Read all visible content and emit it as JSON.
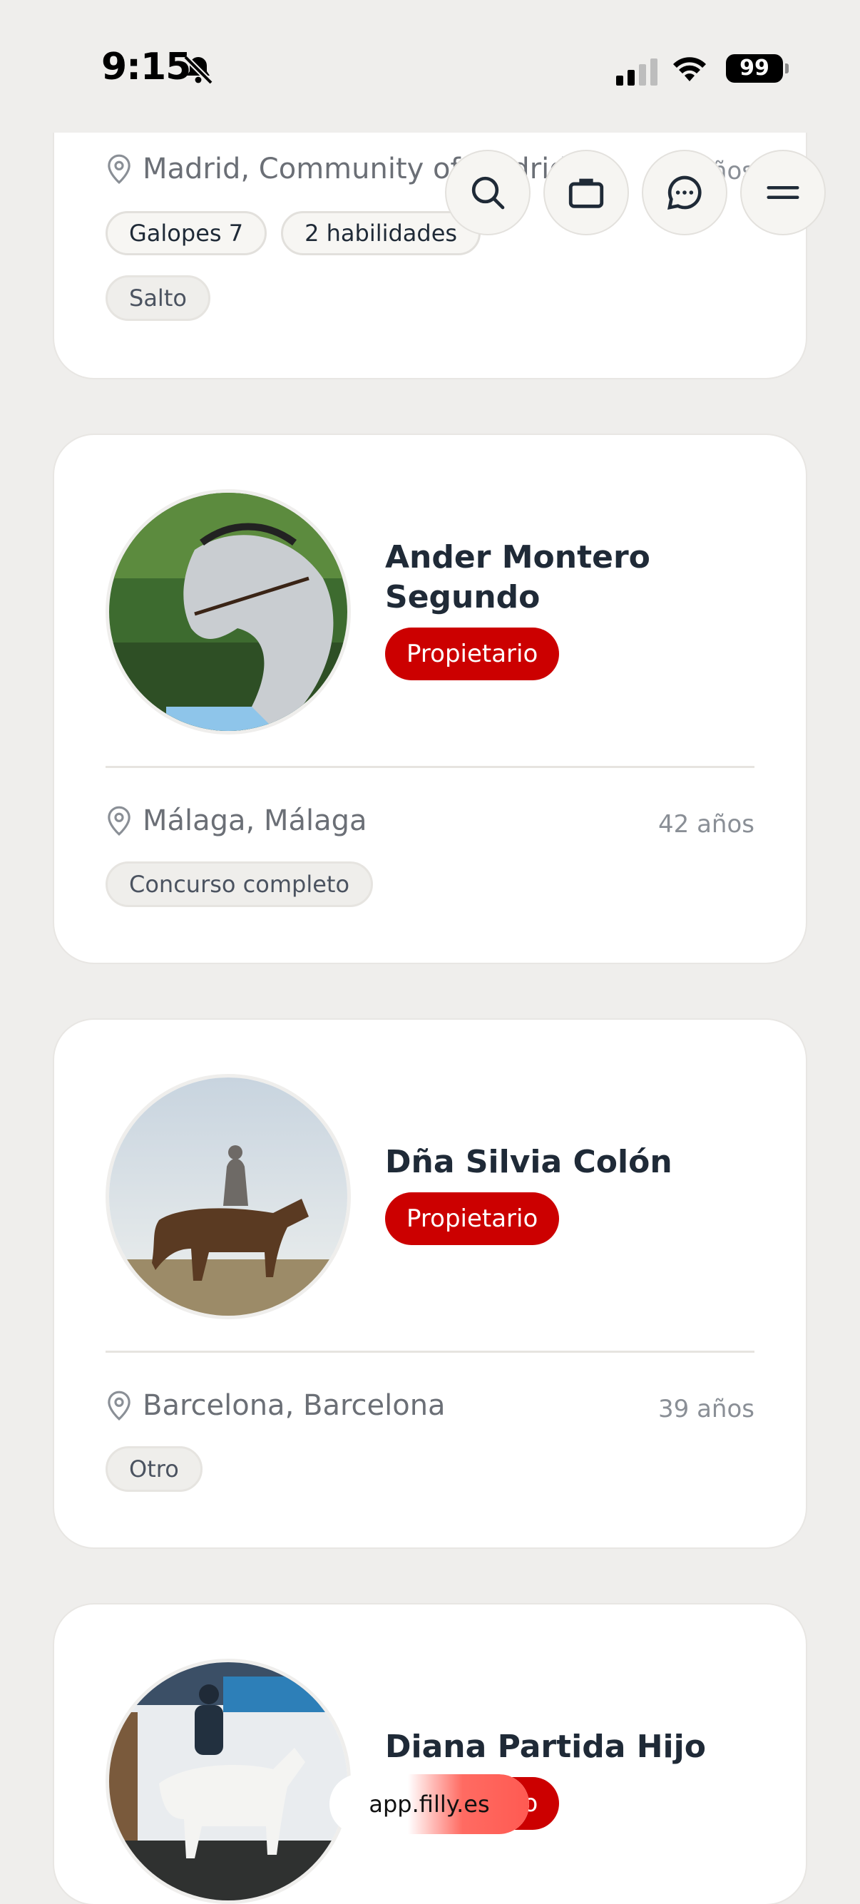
{
  "status": {
    "time": "9:15",
    "battery": "99"
  },
  "top_card": {
    "location": "Madrid, Community of Madrid",
    "age": "años",
    "chips": [
      "Galopes 7",
      "2 habilidades"
    ],
    "discipline": "Salto"
  },
  "nav": {
    "icons": [
      "search-icon",
      "briefcase-icon",
      "chat-icon",
      "menu-icon"
    ]
  },
  "riders": [
    {
      "name_line1": "Ander Montero",
      "name_line2": "Segundo",
      "role": "Propietario",
      "location": "Málaga, Málaga",
      "age": "42 años",
      "discipline": "Concurso completo"
    },
    {
      "name_line1": "Dña Silvia Colón",
      "name_line2": "",
      "role": "Propietario",
      "location": "Barcelona, Barcelona",
      "age": "39 años",
      "discipline": "Otro"
    },
    {
      "name_line1": "Diana Partida Hijo",
      "name_line2": "",
      "role": "Propietario"
    }
  ],
  "browser": {
    "url": "app.filly.es"
  },
  "colors": {
    "accent": "#cc0000",
    "background": "#efeeec",
    "card": "#ffffff"
  }
}
